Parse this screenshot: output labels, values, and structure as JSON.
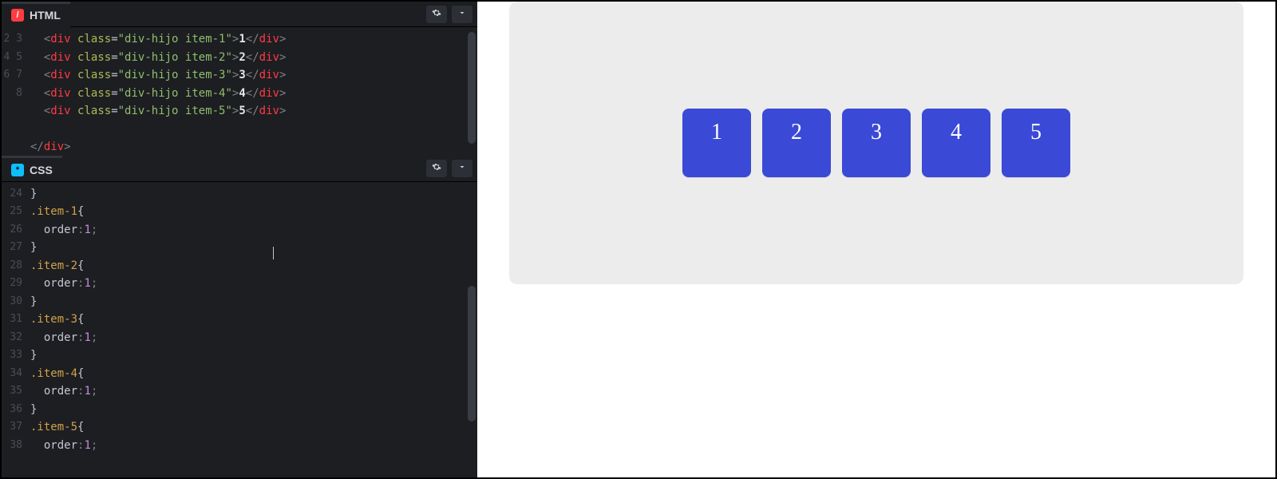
{
  "panels": {
    "html": {
      "label": "HTML",
      "icon_badge": "/",
      "gear_title": "Settings",
      "chevron_title": "Collapse",
      "line_numbers": [
        "2",
        "3",
        "4",
        "5",
        "6",
        "7",
        "8"
      ],
      "lines": [
        {
          "indent": "  ",
          "tag": "div",
          "attr": "class",
          "val": "div-hijo item-1",
          "text": "1"
        },
        {
          "indent": "  ",
          "tag": "div",
          "attr": "class",
          "val": "div-hijo item-2",
          "text": "2"
        },
        {
          "indent": "  ",
          "tag": "div",
          "attr": "class",
          "val": "div-hijo item-3",
          "text": "3"
        },
        {
          "indent": "  ",
          "tag": "div",
          "attr": "class",
          "val": "div-hijo item-4",
          "text": "4"
        },
        {
          "indent": "  ",
          "tag": "div",
          "attr": "class",
          "val": "div-hijo item-5",
          "text": "5"
        }
      ],
      "blank_line": "",
      "closing": {
        "indent": "",
        "tag": "div"
      }
    },
    "css": {
      "label": "CSS",
      "icon_badge": "*",
      "gear_title": "Settings",
      "chevron_title": "Collapse",
      "line_numbers": [
        "24",
        "25",
        "26",
        "27",
        "28",
        "29",
        "30",
        "31",
        "32",
        "33",
        "34",
        "35",
        "36",
        "37",
        "38"
      ],
      "rules": [
        {
          "selector": ".item-1",
          "prop": "order",
          "val": "1"
        },
        {
          "selector": ".item-2",
          "prop": "order",
          "val": "1"
        },
        {
          "selector": ".item-3",
          "prop": "order",
          "val": "1"
        },
        {
          "selector": ".item-4",
          "prop": "order",
          "val": "1"
        },
        {
          "selector": ".item-5",
          "prop": "order",
          "val": "1"
        }
      ],
      "leading_close": "}"
    }
  },
  "preview": {
    "items": [
      "1",
      "2",
      "3",
      "4",
      "5"
    ]
  }
}
